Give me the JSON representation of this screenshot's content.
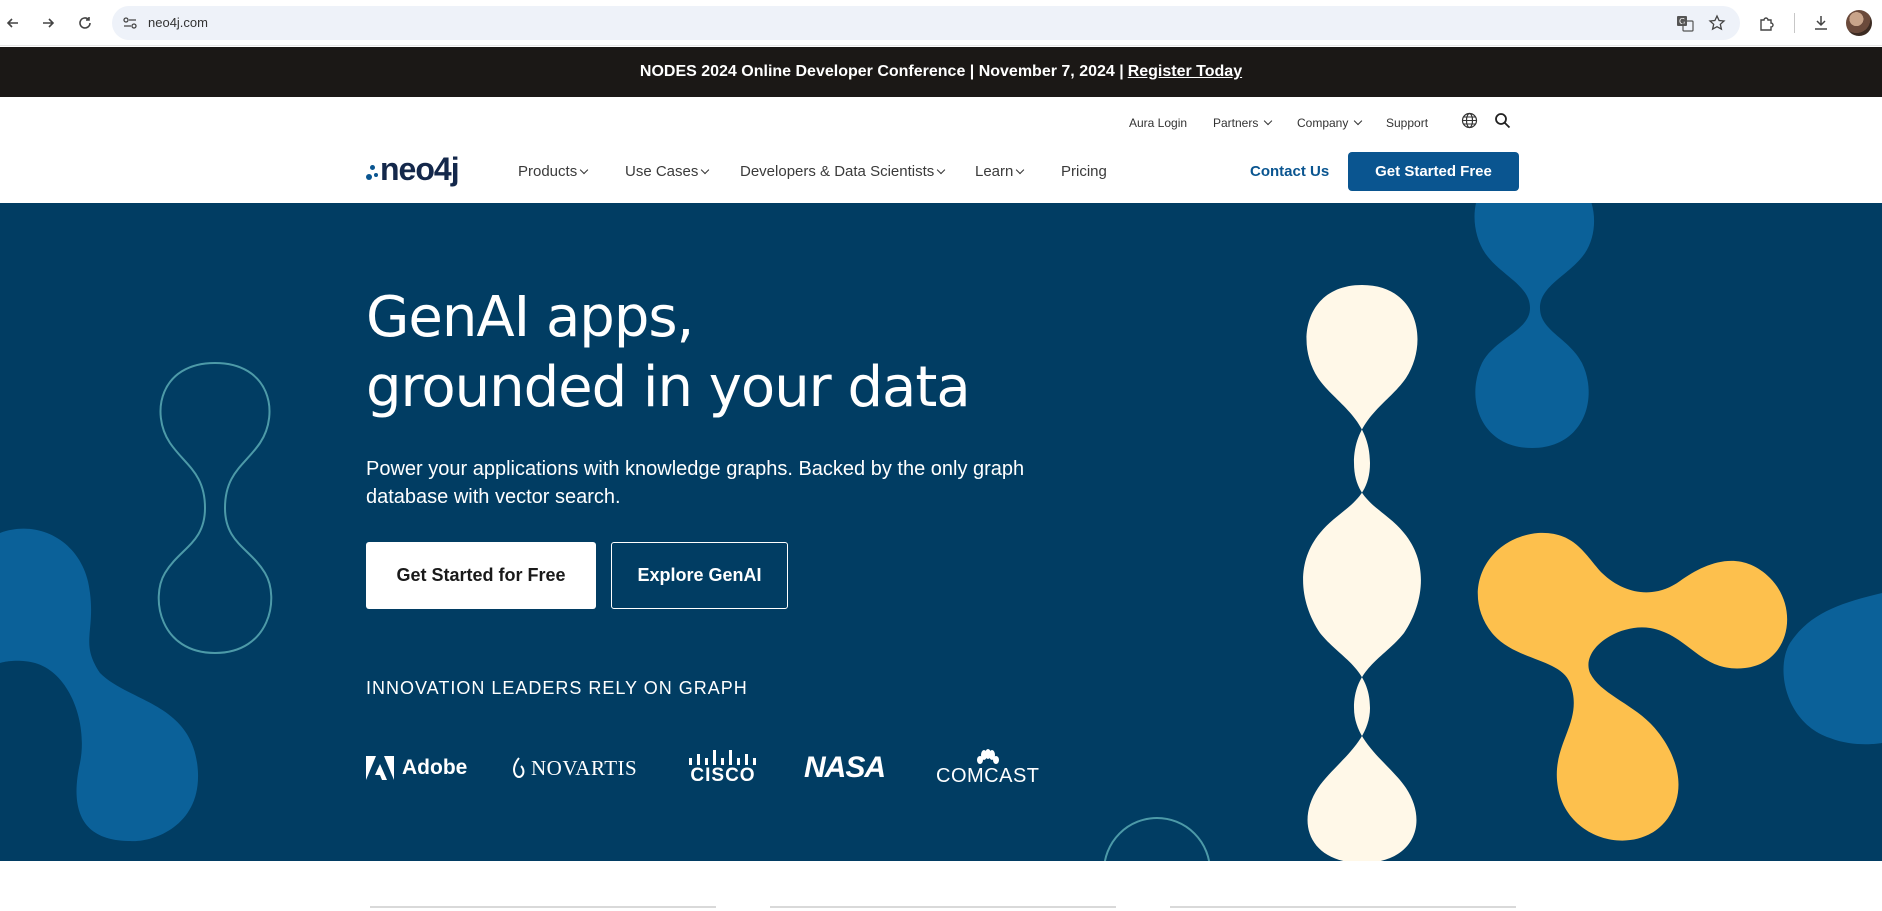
{
  "browser": {
    "url": "neo4j.com",
    "icons": [
      "back-icon",
      "forward-icon",
      "reload-icon",
      "site-info-icon",
      "translate-icon",
      "star-icon",
      "extensions-icon",
      "download-icon",
      "profile-avatar"
    ]
  },
  "announcement": {
    "text": "NODES 2024 Online Developer Conference | November 7, 2024 |",
    "link": "Register Today"
  },
  "utility_nav": {
    "aura_login": "Aura Login",
    "partners": "Partners",
    "company": "Company",
    "support": "Support"
  },
  "logo": {
    "text": "neo4j"
  },
  "main_nav": {
    "products": "Products",
    "use_cases": "Use Cases",
    "developers": "Developers & Data Scientists",
    "learn": "Learn",
    "pricing": "Pricing",
    "contact": "Contact Us",
    "get_started": "Get Started Free"
  },
  "hero": {
    "title_line1": "GenAI apps,",
    "title_line2": "grounded in your data",
    "subtitle": "Power your applications with knowledge graphs. Backed by the only graph database with vector search.",
    "primary_button": "Get Started for Free",
    "secondary_button": "Explore GenAI",
    "leaders_heading": "INNOVATION LEADERS RELY ON GRAPH"
  },
  "customer_logos": {
    "adobe": "Adobe",
    "novartis": "NOVARTIS",
    "cisco": "CISCO",
    "nasa": "NASA",
    "comcast": "COMCAST"
  },
  "colors": {
    "hero_bg": "#013d63",
    "brand_blue": "#0a5590",
    "shape_blue": "#0b6199",
    "cream": "#fff8e8",
    "yellow": "#fdc04d",
    "announce_bg": "#1b1816"
  }
}
